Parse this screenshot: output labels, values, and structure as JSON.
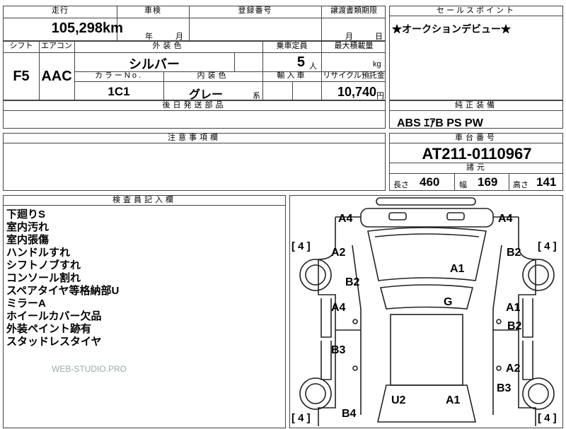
{
  "top_row": {
    "mileage_header": "走行",
    "inspection_header": "車検",
    "registration_header": "登録番号",
    "transfer_header": "譲渡書類期限",
    "mileage_value": "105,298",
    "mileage_unit": "km",
    "inspection_year": "年",
    "inspection_month": "月",
    "transfer_month": "月",
    "transfer_day": "日"
  },
  "row2": {
    "shift_header": "シフト",
    "aircon_header": "エアコン",
    "exterior_color_header": "外装色",
    "capacity_header": "乗車定員",
    "max_load_header": "最大積載量",
    "shift_value": "F5",
    "aircon_value": "AAC",
    "exterior_color_value": "シルバー",
    "capacity_value": "5",
    "capacity_unit": "人",
    "max_load_unit": "kg",
    "color_no_header": "カラーNo.",
    "interior_color_header": "内装色",
    "import_header": "輸入車",
    "recycle_header": "リサイクル預託金",
    "color_no_value": "1C1",
    "interior_color_value": "グレー",
    "interior_suffix": "系",
    "recycle_value": "10,740",
    "recycle_unit": "円"
  },
  "later_parts": {
    "header": "後日発送部品",
    "value": ""
  },
  "sales_point": {
    "header": "セールスポイント",
    "value": "★オークションデビュー★"
  },
  "equipment": {
    "header": "純正装備",
    "value": "ABS ｴｱB PS PW"
  },
  "caution": {
    "header": "注意事項欄",
    "value": ""
  },
  "chassis": {
    "header": "車台番号",
    "value": "AT211-0110967"
  },
  "specs": {
    "header": "諸元",
    "length_label": "長さ",
    "length_value": "460",
    "width_label": "幅",
    "width_value": "169",
    "height_label": "高さ",
    "height_value": "141"
  },
  "inspector": {
    "header": "検査員記入欄",
    "lines": [
      "下廻りS",
      "室内汚れ",
      "室内張傷",
      "ハンドルすれ",
      "シフトノブすれ",
      "コンソール割れ",
      "スペアタイヤ等格納部U",
      "ミラーA",
      "ホイールカバー欠品",
      "外装ペイント跡有",
      "スタッドレスタイヤ"
    ],
    "watermark": "WEB-STUDIO.PRO"
  },
  "diagram": {
    "tire_marks": [
      "[ 4 ]",
      "[ 4 ]",
      "[ 4 ]",
      "[ 4 ]"
    ],
    "damage_codes": {
      "front_left": "A4",
      "front_right": "A4",
      "fender_fl": "A2",
      "fender_fr": "B2",
      "hood_left": "B2",
      "hood": "A1",
      "door_fl": "A4",
      "roof": "G",
      "door_fr_a": "A1",
      "door_fr_b": "B2",
      "door_rl": "B3",
      "door_rr": "A2",
      "rear_fender_r": "B3",
      "trunk_left": "U2",
      "trunk_right": "A1",
      "rear_left": "B4"
    }
  }
}
